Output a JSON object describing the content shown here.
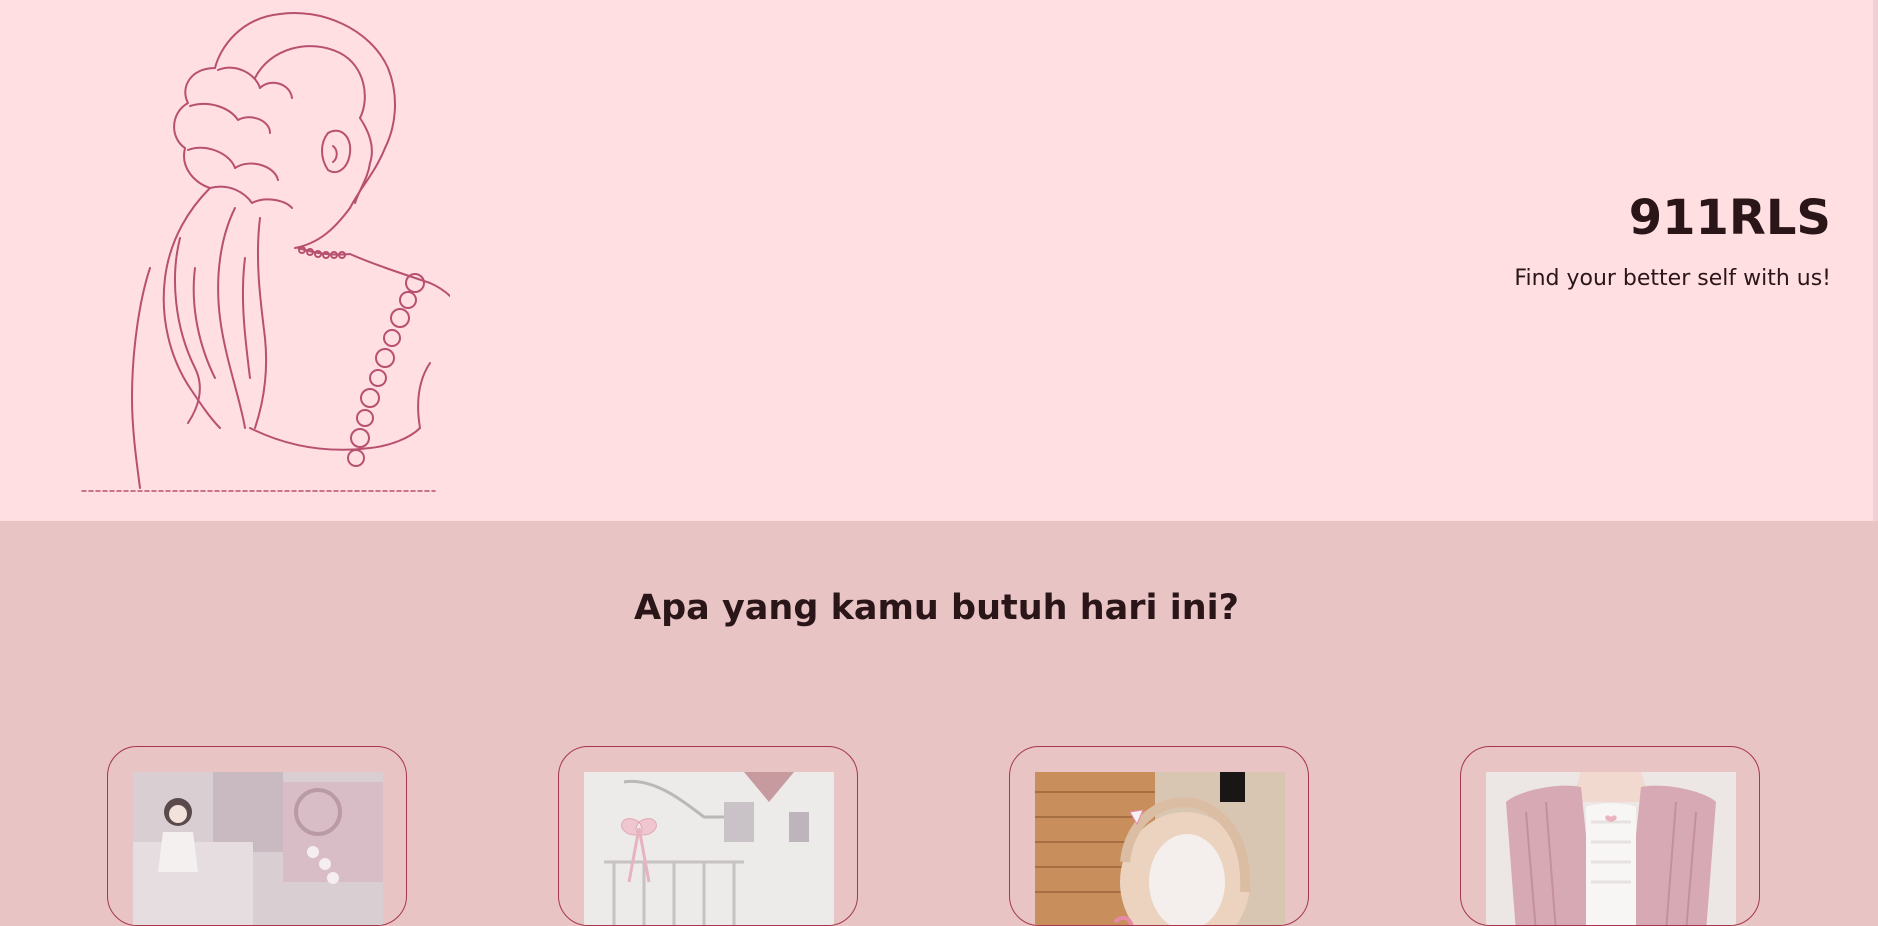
{
  "hero": {
    "brand": "911RLS",
    "tagline": "Find your better self with us!",
    "illustration": "woman-back-line-art",
    "background": "#ffdfe2",
    "line_color": "#b8506f"
  },
  "section": {
    "title": "Apa yang kamu butuh hari ini?",
    "background": "#e8c4c5"
  },
  "cards": [
    {
      "image": "doll-accessories-photo"
    },
    {
      "image": "bedroom-bow-photo"
    },
    {
      "image": "wig-mannequin-photo"
    },
    {
      "image": "pink-cardigan-photo"
    }
  ],
  "colors": {
    "text": "#2a1518",
    "card_border": "#a6374f"
  }
}
